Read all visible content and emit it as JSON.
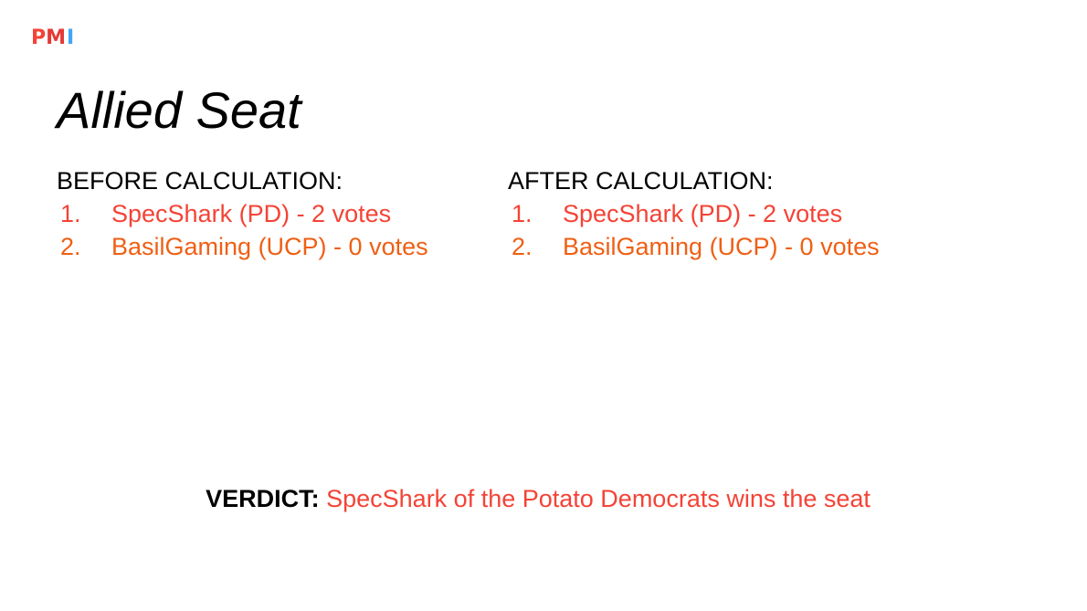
{
  "logo": {
    "letter_1": "P",
    "letter_2": "M",
    "letter_3": "I",
    "colors": [
      "#f44336",
      "#e53935",
      "#42a5f5"
    ]
  },
  "slide": {
    "title": "Allied Seat",
    "before": {
      "heading": "BEFORE CALCULATION:",
      "items": [
        {
          "number": "1.",
          "text": "SpecShark (PD) - 2 votes",
          "color": "#f44336"
        },
        {
          "number": "2.",
          "text": "BasilGaming (UCP) - 0 votes",
          "color": "#ef5f14"
        }
      ]
    },
    "after": {
      "heading": "AFTER CALCULATION:",
      "items": [
        {
          "number": "1.",
          "text": "SpecShark (PD) - 2 votes",
          "color": "#f44336"
        },
        {
          "number": "2.",
          "text": "BasilGaming (UCP) - 0 votes",
          "color": "#ef5f14"
        }
      ]
    },
    "verdict": {
      "label": "VERDICT:",
      "text": "SpecShark of the Potato Democrats wins the seat"
    }
  }
}
